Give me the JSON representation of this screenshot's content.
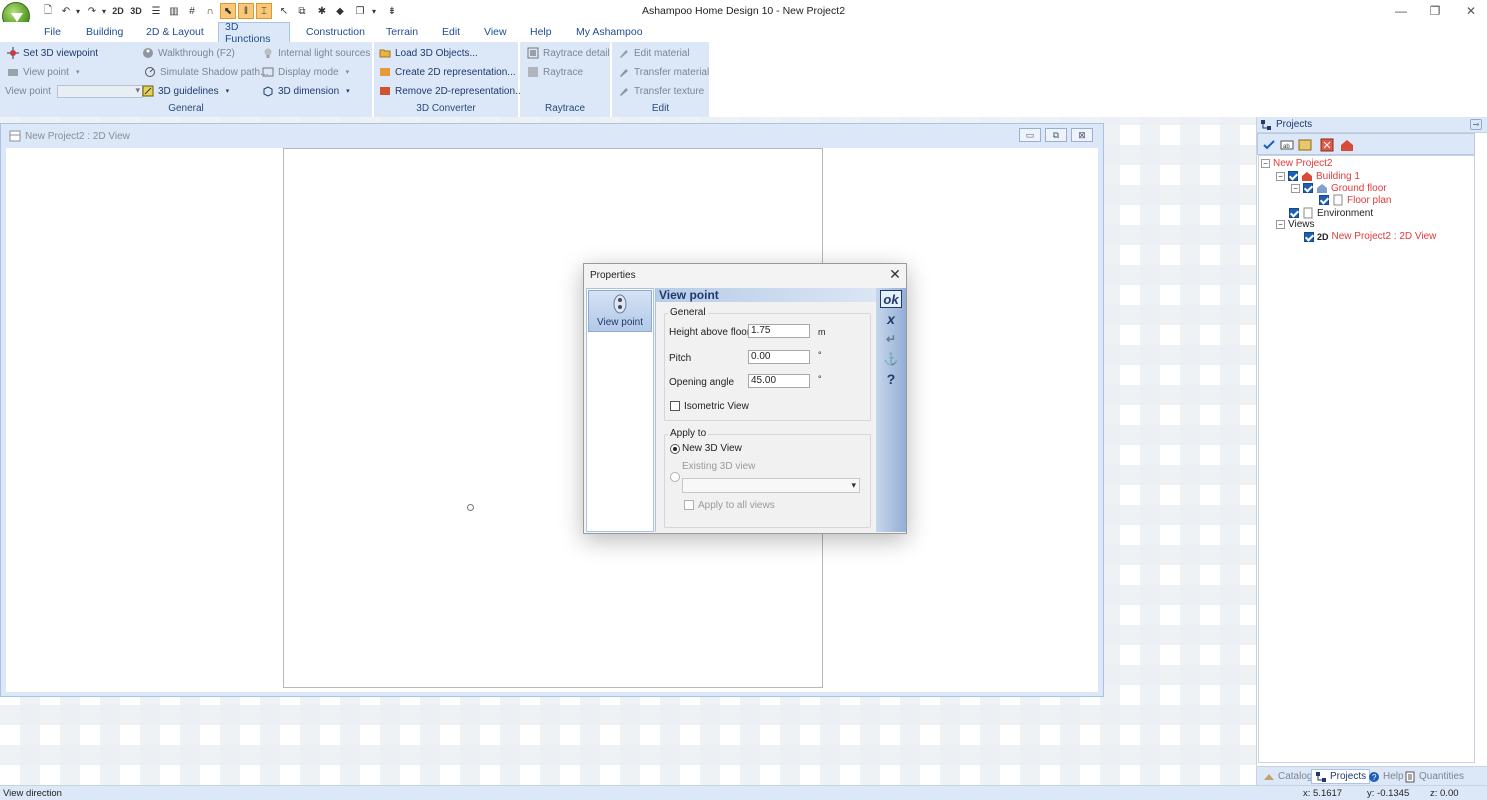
{
  "title_bar": {
    "title": "Ashampoo Home Design 10 - New Project2",
    "quick_access": [
      {
        "icon": "new-file-icon",
        "glyph": "🗋"
      },
      {
        "icon": "undo-icon",
        "glyph": "↶"
      },
      {
        "icon": "dropdown-icon",
        "glyph": "▾"
      },
      {
        "icon": "redo-icon",
        "glyph": "↷"
      },
      {
        "icon": "dropdown-icon",
        "glyph": "▾"
      },
      {
        "icon": "2d-view-icon",
        "glyph": "2D"
      },
      {
        "icon": "3d-view-icon",
        "glyph": "3D"
      },
      {
        "icon": "split-horizontal-icon",
        "glyph": "☰"
      },
      {
        "icon": "split-vertical-icon",
        "glyph": "▥"
      },
      {
        "icon": "grid-icon",
        "glyph": "#"
      },
      {
        "icon": "magnet-icon",
        "glyph": "∩"
      },
      {
        "icon": "select-icon",
        "glyph": "⬉"
      },
      {
        "icon": "guide-lines-icon",
        "glyph": "‖"
      },
      {
        "icon": "measure-icon",
        "glyph": "⌶"
      },
      {
        "icon": "pointer-icon",
        "glyph": "↖"
      },
      {
        "icon": "copy-icon",
        "glyph": "⧉"
      },
      {
        "icon": "wand-icon",
        "glyph": "✱"
      },
      {
        "icon": "paint-icon",
        "glyph": "◆"
      },
      {
        "icon": "multi-view-icon",
        "glyph": "❐"
      },
      {
        "icon": "dropdown-icon",
        "glyph": "▾"
      },
      {
        "icon": "customize-icon",
        "glyph": "⇟"
      }
    ],
    "window_controls": {
      "minimize": "—",
      "restore": "❐",
      "close": "✕"
    }
  },
  "menu_tabs": [
    "File",
    "Building",
    "2D & Layout",
    "3D Functions",
    "Construction",
    "Terrain",
    "Edit",
    "View",
    "Help",
    "My Ashampoo"
  ],
  "active_tab": "3D Functions",
  "ribbon": {
    "general": {
      "label": "General",
      "set_3d_viewpoint": "Set 3D viewpoint",
      "view_point_button": "View point",
      "view_point_label": "View point",
      "view_point_value": "",
      "walkthrough": "Walkthrough (F2)",
      "simulate_shadow": "Simulate Shadow path...",
      "guidelines_3d": "3D guidelines",
      "internal_light": "Internal light sources",
      "display_mode": "Display mode",
      "dimension_3d": "3D dimension"
    },
    "converter": {
      "label": "3D Converter",
      "load_3d": "Load 3D Objects...",
      "create_2d": "Create 2D representation...",
      "remove_2d": "Remove 2D-representation..."
    },
    "raytrace": {
      "label": "Raytrace",
      "detail": "Raytrace detail",
      "raytrace": "Raytrace"
    },
    "edit": {
      "label": "Edit",
      "edit_material": "Edit material",
      "transfer_material": "Transfer material",
      "transfer_texture": "Transfer texture"
    }
  },
  "doc_window": {
    "title": "New Project2 : 2D View",
    "controls": {
      "minimize": "▭",
      "restore": "⧉",
      "close": "⊠"
    }
  },
  "dialog": {
    "title": "Properties",
    "close": "✕",
    "left_item": "View point",
    "header": "View point",
    "general_group": "General",
    "height_label": "Height above floor",
    "height_value": "1.75",
    "height_unit": "m",
    "pitch_label": "Pitch",
    "pitch_value": "0.00",
    "pitch_unit": "°",
    "opening_label": "Opening angle",
    "opening_value": "45.00",
    "opening_unit": "°",
    "isometric_label": "Isometric View",
    "isometric_checked": false,
    "apply_group": "Apply to",
    "new_3d_view": "New 3D View",
    "existing_3d_view": "Existing 3D view",
    "existing_value": "",
    "apply_all_views": "Apply to all views",
    "side_buttons": {
      "ok": "ok",
      "cancel": "x",
      "apply": "↵",
      "anchor": "⚓",
      "help": "?"
    }
  },
  "projects_panel": {
    "title": "Projects",
    "tree": {
      "project": "New Project2",
      "building": "Building 1",
      "floor": "Ground floor",
      "plan": "Floor plan",
      "environment": "Environment",
      "views": "Views",
      "view_badge": "2D",
      "view_item": "New Project2 : 2D View"
    },
    "bottom_tabs": [
      "Catalog",
      "Projects",
      "Help",
      "Quantities"
    ],
    "active_bottom_tab": "Projects"
  },
  "status_bar": {
    "text": "View direction",
    "x": "x: 5.1617",
    "y": "y: -0.1345",
    "z": "z: 0.00"
  },
  "colors": {
    "accent": "#dce8f7",
    "tab_text": "#1e4e90",
    "tree_red": "#e03a3a",
    "checkbox_blue": "#1c5fb5"
  }
}
